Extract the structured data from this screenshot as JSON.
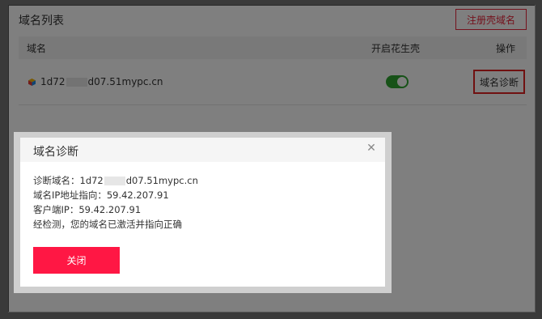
{
  "panel": {
    "title": "域名列表",
    "register_button": "注册壳域名"
  },
  "table": {
    "headers": {
      "name": "域名",
      "shell": "开启花生壳",
      "op": "操作"
    },
    "rows": [
      {
        "domain_prefix": "1d72",
        "domain_suffix": "d07.51mypc.cn",
        "shell_enabled": true,
        "action": "域名诊断"
      }
    ]
  },
  "modal": {
    "title": "域名诊断",
    "close_icon": "close-icon",
    "lines": {
      "domain_label": "诊断域名：",
      "domain_prefix": "1d72",
      "domain_suffix": "d07.51mypc.cn",
      "ip_pointing": "域名IP地址指向：59.42.207.91",
      "client_ip": "客户端IP：59.42.207.91",
      "result": "经检测，您的域名已激活并指向正确"
    },
    "close_button": "关闭"
  },
  "colors": {
    "accent": "#ff1744",
    "toggle_on": "#2fa430",
    "highlight_border": "#e02020"
  }
}
